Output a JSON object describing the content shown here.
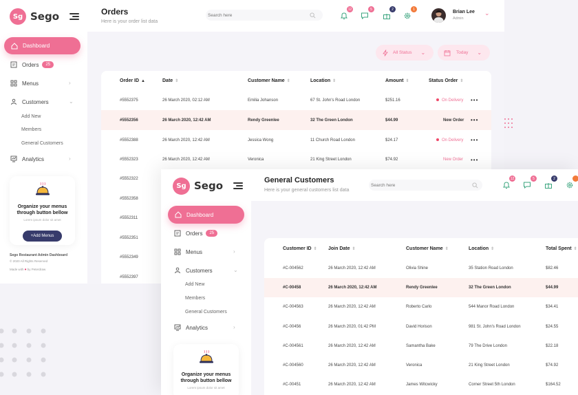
{
  "brand": {
    "logo_mark": "Sg",
    "name": "Sego"
  },
  "nav": {
    "dashboard": "Dashboard",
    "orders": "Orders",
    "orders_badge": "25",
    "menus": "Menus",
    "customers": "Customers",
    "add_new": "Add New",
    "members": "Members",
    "general_customers": "General Customers",
    "analytics": "Analytics"
  },
  "promo": {
    "title": "Organize your menus through button bellow",
    "subtitle": "Lorem ipsum dolor sit amet",
    "button": "+Add Menus"
  },
  "footer": {
    "app": "Sego Restaurant Admin Dashboard",
    "rights": "© 2020 All Rights Reserved",
    "made_pre": "Made with",
    "made_post": "by Peterdraw"
  },
  "header": {
    "title": "Orders",
    "subtitle": "Here is your order list data",
    "search_placeholder": "Search here",
    "badges": [
      "12",
      "5",
      "2",
      "1"
    ],
    "user_name": "Brian Lee",
    "user_role": "Admin"
  },
  "filters": {
    "status": "All Status",
    "date": "Today"
  },
  "orders": {
    "columns": [
      "Order ID",
      "Date",
      "Customer Name",
      "Location",
      "Amount",
      "Status Order"
    ],
    "rows": [
      {
        "id": "#5552375",
        "date": "26 March 2020, 02:12 AM",
        "name": "Emilia Johanson",
        "loc": "67 St. John's Road London",
        "amount": "$251.16",
        "status": "On Delivery"
      },
      {
        "id": "#5552356",
        "date": "26 March 2020, 12:42 AM",
        "name": "Rendy Greenlee",
        "loc": "32 The Green London",
        "amount": "$44.99",
        "status": "New Order"
      },
      {
        "id": "#5552388",
        "date": "26 March 2020, 12:42 AM",
        "name": "Jessica Wong",
        "loc": "11 Church Road London",
        "amount": "$24.17",
        "status": "On Delivery"
      },
      {
        "id": "#5552323",
        "date": "26 March 2020, 12:42 AM",
        "name": "Veronica",
        "loc": "21 King Street London",
        "amount": "$74.92",
        "status": "New Order"
      }
    ],
    "extra_ids": [
      "#5552322",
      "#5552358",
      "#5552311",
      "#5552351",
      "#5552349",
      "#5552397"
    ]
  },
  "panel2": {
    "title": "General Customers",
    "subtitle": "Here is your general customers list data",
    "search_placeholder": "Search here",
    "badges": [
      "12",
      "5",
      "2"
    ],
    "columns": [
      "Customer ID",
      "Join Date",
      "Customer Name",
      "Location",
      "Total Spent"
    ],
    "rows": [
      {
        "id": "#C-004562",
        "date": "26 March 2020, 12:42 AM",
        "name": "Olivia Shine",
        "loc": "35 Station Road London",
        "spent": "$82.46"
      },
      {
        "id": "#C-00458",
        "date": "26 March 2020, 12:42 AM",
        "name": "Rendy Greenlee",
        "loc": "32 The Green London",
        "spent": "$44.99"
      },
      {
        "id": "#C-004563",
        "date": "26 March 2020, 12:42 AM",
        "name": "Roberto Carlo",
        "loc": "544 Manor Road London",
        "spent": "$34.41"
      },
      {
        "id": "#C-00456",
        "date": "26 March 2020, 01:42 PM",
        "name": "David Horison",
        "loc": "981 St. John's Road London",
        "spent": "$24.55"
      },
      {
        "id": "#C-004561",
        "date": "26 March 2020, 12:42 AM",
        "name": "Samantha Bake",
        "loc": "79 The Drive London",
        "spent": "$22.18"
      },
      {
        "id": "#C-004560",
        "date": "26 March 2020, 12:42 AM",
        "name": "Veronica",
        "loc": "21 King Street London",
        "spent": "$74.92"
      },
      {
        "id": "#C-00451",
        "date": "26 March 2020, 12:42 AM",
        "name": "James Witcwicky",
        "loc": "Corner Street 5th London",
        "spent": "$164.52"
      }
    ]
  },
  "colors": {
    "accent": "#ef6f94",
    "dark_button": "#373b6b",
    "highlight_row": "#fdf1ef"
  },
  "icons": [
    "hamburger-icon",
    "search-icon",
    "bell-icon",
    "chat-icon",
    "gift-icon",
    "gear-icon",
    "home-icon",
    "orders-icon",
    "grid-icon",
    "customers-icon",
    "analytics-icon",
    "cloche-icon",
    "calendar-icon",
    "bolt-icon",
    "heart-icon"
  ]
}
